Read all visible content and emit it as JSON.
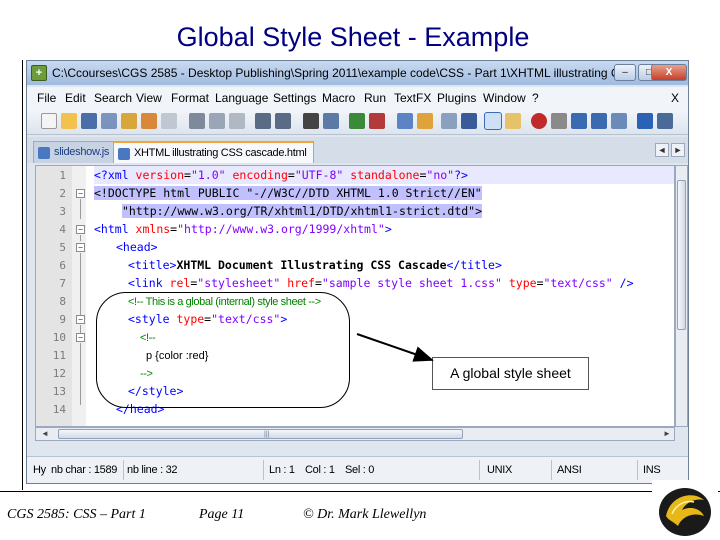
{
  "slide": {
    "title": "Global Style Sheet - Example",
    "callout": "A global style sheet"
  },
  "window": {
    "title": "C:\\Ccourses\\CGS 2585 - Desktop Publishing\\Spring 2011\\example code\\CSS - Part 1\\XHTML illustrating CSS cascade.h...",
    "min_glyph": "–",
    "max_glyph": "□",
    "close_glyph": "X"
  },
  "menu": {
    "items": [
      "File",
      "Edit",
      "Search",
      "View",
      "Format",
      "Language",
      "Settings",
      "Macro",
      "Run",
      "TextFX",
      "Plugins",
      "Window",
      "?"
    ],
    "close": "X"
  },
  "tabs": [
    {
      "label": "slideshow.js",
      "active": false
    },
    {
      "label": "XHTML illustrating CSS cascade.html",
      "active": true
    }
  ],
  "editor": {
    "line_numbers": [
      "1",
      "2",
      "3",
      "4",
      "5",
      "6",
      "7",
      "8",
      "9",
      "10",
      "11",
      "12",
      "13",
      "14"
    ],
    "lines": {
      "l1_a": "<?xml ",
      "l1_b": "version",
      "l1_c": "=",
      "l1_d": "\"1.0\"",
      "l1_e": " encoding",
      "l1_f": "=",
      "l1_g": "\"UTF-8\"",
      "l1_h": " standalone",
      "l1_i": "=",
      "l1_j": "\"no\"",
      "l1_k": "?>",
      "l2_a": "<!DOCTYPE html PUBLIC \"-//W3C//DTD XHTML 1.0 Strict//EN\"",
      "l3_a": "\"http://www.w3.org/TR/xhtml1/DTD/xhtml1-strict.dtd\">",
      "l4_a": "<html ",
      "l4_b": "xmlns",
      "l4_c": "=",
      "l4_d": "\"http://www.w3.org/1999/xhtml\"",
      "l4_e": ">",
      "l5_a": "<head>",
      "l6_a": "<title>",
      "l6_b": "XHTML Document Illustrating CSS Cascade",
      "l6_c": "</title>",
      "l7_a": "<link ",
      "l7_b": "rel",
      "l7_c": "=",
      "l7_d": "\"stylesheet\"",
      "l7_e": " href",
      "l7_f": "=",
      "l7_g": "\"sample style sheet 1.css\"",
      "l7_h": " type",
      "l7_i": "=",
      "l7_j": "\"text/css\"",
      "l7_k": " />",
      "l8_a": "<!-- This is a global (internal) style sheet -->",
      "l9_a": "<style ",
      "l9_b": "type",
      "l9_c": "=",
      "l9_d": "\"text/css\"",
      "l9_e": ">",
      "l10_a": "<!--",
      "l11_a": "p {color :red}",
      "l12_a": "-->",
      "l13_a": "</style>",
      "l14_a": "</head>"
    }
  },
  "status": {
    "lang": "Hy",
    "chars": "nb char : 1589",
    "lines": "nb line : 32",
    "ln": "Ln : 1",
    "col": "Col : 1",
    "sel": "Sel : 0",
    "eol": "UNIX",
    "enc": "ANSI",
    "mode": "INS"
  },
  "footer": {
    "course": "CGS 2585: CSS – Part 1",
    "page": "Page 11",
    "author": "© Dr. Mark Llewellyn"
  },
  "colors": {
    "title": "#000080",
    "tag": "#0000ff",
    "attr": "#ff0000",
    "string": "#8000ff",
    "comment": "#008000"
  }
}
